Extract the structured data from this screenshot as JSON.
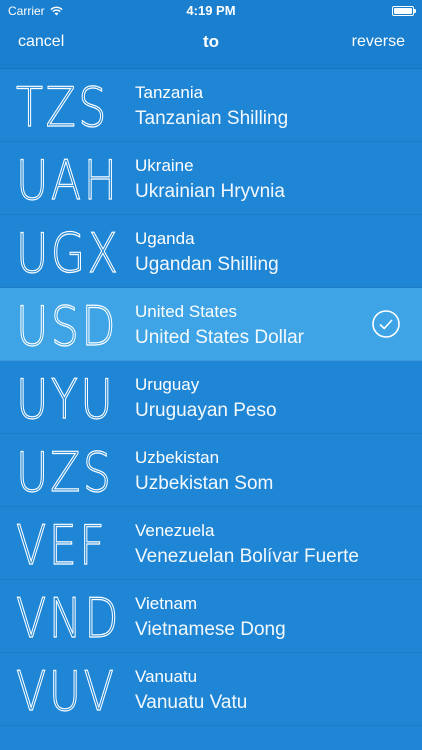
{
  "status_bar": {
    "carrier": "Carrier",
    "time": "4:19 PM"
  },
  "nav": {
    "cancel_label": "cancel",
    "title": "to",
    "reverse_label": "reverse"
  },
  "currencies": [
    {
      "code": "TZS",
      "country": "Tanzania",
      "name": "Tanzanian Shilling",
      "selected": false
    },
    {
      "code": "UAH",
      "country": "Ukraine",
      "name": "Ukrainian Hryvnia",
      "selected": false
    },
    {
      "code": "UGX",
      "country": "Uganda",
      "name": "Ugandan Shilling",
      "selected": false
    },
    {
      "code": "USD",
      "country": "United States",
      "name": "United States Dollar",
      "selected": true
    },
    {
      "code": "UYU",
      "country": "Uruguay",
      "name": "Uruguayan Peso",
      "selected": false
    },
    {
      "code": "UZS",
      "country": "Uzbekistan",
      "name": "Uzbekistan Som",
      "selected": false
    },
    {
      "code": "VEF",
      "country": "Venezuela",
      "name": "Venezuelan Bolívar Fuerte",
      "selected": false
    },
    {
      "code": "VND",
      "country": "Vietnam",
      "name": "Vietnamese Dong",
      "selected": false
    },
    {
      "code": "VUV",
      "country": "Vanuatu",
      "name": "Vanuatu Vatu",
      "selected": false
    }
  ],
  "colors": {
    "background": "#1f86d6",
    "header": "#1a7fcf",
    "selected_row": "#3ea4e6",
    "text": "#ffffff"
  }
}
